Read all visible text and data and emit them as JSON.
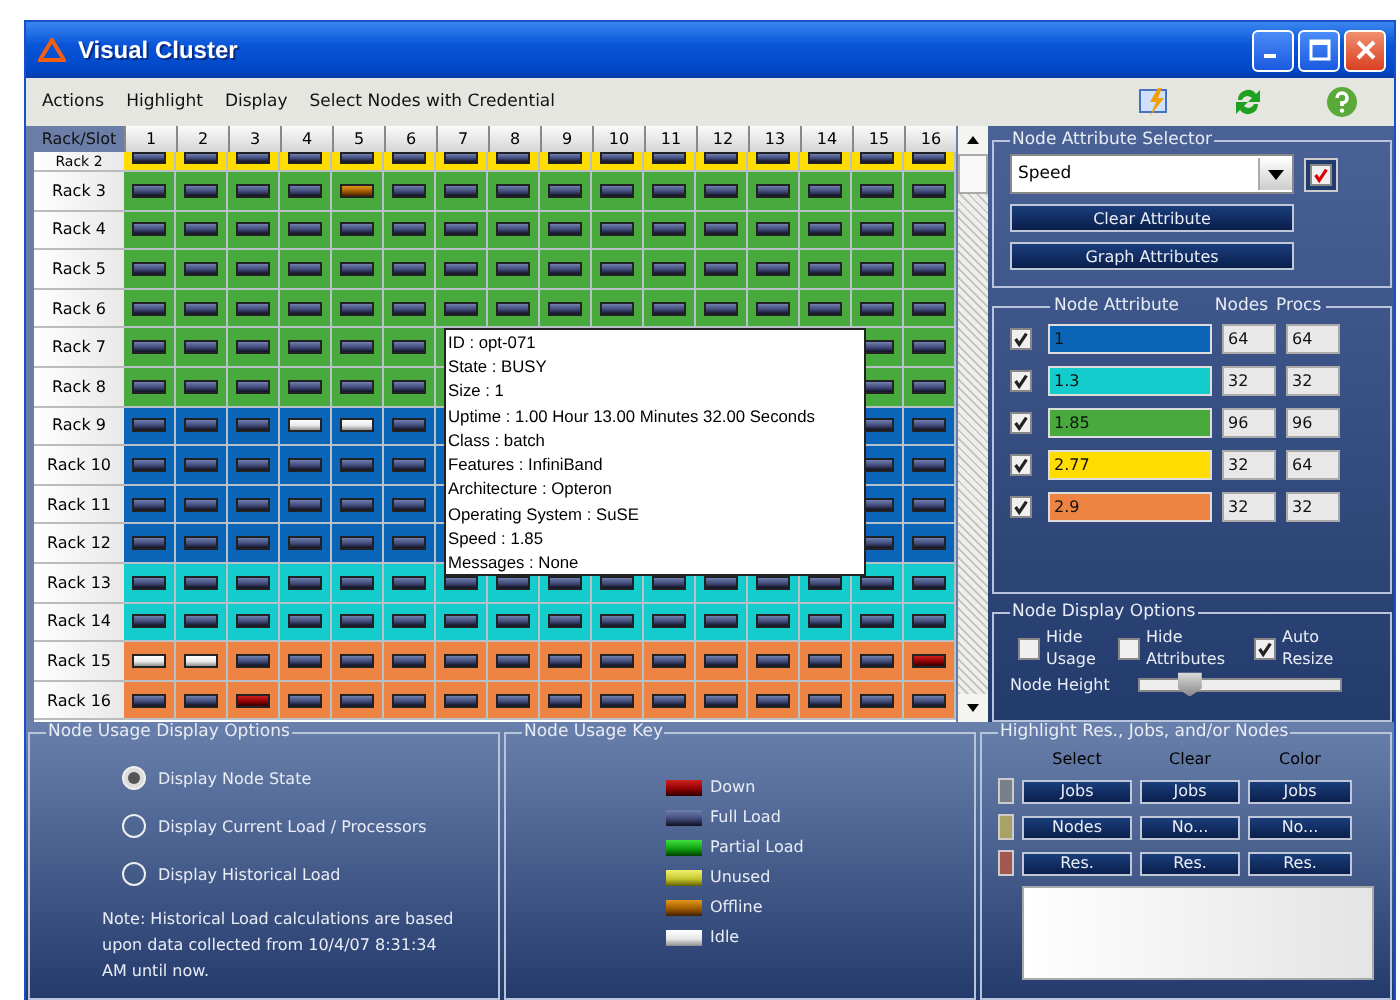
{
  "window": {
    "title": "Visual Cluster"
  },
  "menu": [
    "Actions",
    "Highlight",
    "Display",
    "Select Nodes with Credential"
  ],
  "grid": {
    "corner": "Rack/Slot",
    "slots": [
      "1",
      "2",
      "3",
      "4",
      "5",
      "6",
      "7",
      "8",
      "9",
      "10",
      "11",
      "12",
      "13",
      "14",
      "15",
      "16"
    ],
    "racks": [
      {
        "label": "Rack 2",
        "color": "#ffdd00",
        "nodes": [
          {
            "kind": "full"
          },
          {
            "kind": "full"
          },
          {
            "kind": "full"
          },
          {
            "kind": "full"
          },
          {
            "kind": "full"
          },
          {
            "kind": "full"
          },
          {
            "kind": "full"
          },
          {
            "kind": "full"
          },
          {
            "kind": "full"
          },
          {
            "kind": "full"
          },
          {
            "kind": "full"
          },
          {
            "kind": "full"
          },
          {
            "kind": "full"
          },
          {
            "kind": "full"
          },
          {
            "kind": "full"
          },
          {
            "kind": "full"
          }
        ]
      },
      {
        "label": "Rack 3",
        "color": "#48aa3c",
        "nodes": [
          {
            "kind": "full"
          },
          {
            "kind": "full"
          },
          {
            "kind": "full"
          },
          {
            "kind": "full"
          },
          {
            "kind": "offline"
          },
          {
            "kind": "full"
          },
          {
            "kind": "full"
          },
          {
            "kind": "full"
          },
          {
            "kind": "full"
          },
          {
            "kind": "full"
          },
          {
            "kind": "full"
          },
          {
            "kind": "full"
          },
          {
            "kind": "full"
          },
          {
            "kind": "full"
          },
          {
            "kind": "full"
          },
          {
            "kind": "full"
          }
        ]
      },
      {
        "label": "Rack 4",
        "color": "#48aa3c",
        "nodes": [
          {
            "kind": "full"
          },
          {
            "kind": "full"
          },
          {
            "kind": "full"
          },
          {
            "kind": "full"
          },
          {
            "kind": "full"
          },
          {
            "kind": "full"
          },
          {
            "kind": "full"
          },
          {
            "kind": "full"
          },
          {
            "kind": "full"
          },
          {
            "kind": "full"
          },
          {
            "kind": "full"
          },
          {
            "kind": "full"
          },
          {
            "kind": "full"
          },
          {
            "kind": "full"
          },
          {
            "kind": "full"
          },
          {
            "kind": "full"
          }
        ]
      },
      {
        "label": "Rack 5",
        "color": "#48aa3c",
        "nodes": [
          {
            "kind": "full"
          },
          {
            "kind": "full"
          },
          {
            "kind": "full"
          },
          {
            "kind": "full"
          },
          {
            "kind": "full"
          },
          {
            "kind": "full"
          },
          {
            "kind": "full"
          },
          {
            "kind": "full"
          },
          {
            "kind": "full"
          },
          {
            "kind": "full"
          },
          {
            "kind": "full"
          },
          {
            "kind": "full"
          },
          {
            "kind": "full"
          },
          {
            "kind": "full"
          },
          {
            "kind": "full"
          },
          {
            "kind": "full"
          }
        ]
      },
      {
        "label": "Rack 6",
        "color": "#48aa3c",
        "nodes": [
          {
            "kind": "full"
          },
          {
            "kind": "full"
          },
          {
            "kind": "full"
          },
          {
            "kind": "full"
          },
          {
            "kind": "full"
          },
          {
            "kind": "full"
          },
          {
            "kind": "full"
          },
          {
            "kind": "full"
          },
          {
            "kind": "full"
          },
          {
            "kind": "full"
          },
          {
            "kind": "full"
          },
          {
            "kind": "full"
          },
          {
            "kind": "full"
          },
          {
            "kind": "full"
          },
          {
            "kind": "full"
          },
          {
            "kind": "full"
          }
        ]
      },
      {
        "label": "Rack 7",
        "color": "#48aa3c",
        "nodes": [
          {
            "kind": "full"
          },
          {
            "kind": "full"
          },
          {
            "kind": "full"
          },
          {
            "kind": "full"
          },
          {
            "kind": "full"
          },
          {
            "kind": "full"
          },
          {
            "kind": "hidden"
          },
          {
            "kind": "hidden"
          },
          {
            "kind": "hidden"
          },
          {
            "kind": "hidden"
          },
          {
            "kind": "hidden"
          },
          {
            "kind": "hidden"
          },
          {
            "kind": "hidden"
          },
          {
            "kind": "hidden"
          },
          {
            "kind": "full"
          },
          {
            "kind": "full"
          }
        ]
      },
      {
        "label": "Rack 8",
        "color": "#48aa3c",
        "nodes": [
          {
            "kind": "full"
          },
          {
            "kind": "full"
          },
          {
            "kind": "full"
          },
          {
            "kind": "full"
          },
          {
            "kind": "full"
          },
          {
            "kind": "full"
          },
          {
            "kind": "hidden"
          },
          {
            "kind": "hidden"
          },
          {
            "kind": "hidden"
          },
          {
            "kind": "hidden"
          },
          {
            "kind": "hidden"
          },
          {
            "kind": "hidden"
          },
          {
            "kind": "hidden"
          },
          {
            "kind": "hidden"
          },
          {
            "kind": "full"
          },
          {
            "kind": "full"
          }
        ]
      },
      {
        "label": "Rack 9",
        "color": "#0a64b8",
        "nodes": [
          {
            "kind": "full"
          },
          {
            "kind": "full"
          },
          {
            "kind": "full"
          },
          {
            "kind": "idle"
          },
          {
            "kind": "idle"
          },
          {
            "kind": "full"
          },
          {
            "kind": "hidden"
          },
          {
            "kind": "hidden"
          },
          {
            "kind": "hidden"
          },
          {
            "kind": "hidden"
          },
          {
            "kind": "hidden"
          },
          {
            "kind": "hidden"
          },
          {
            "kind": "hidden"
          },
          {
            "kind": "hidden"
          },
          {
            "kind": "full"
          },
          {
            "kind": "full"
          }
        ]
      },
      {
        "label": "Rack 10",
        "color": "#0a64b8",
        "nodes": [
          {
            "kind": "full"
          },
          {
            "kind": "full"
          },
          {
            "kind": "full"
          },
          {
            "kind": "full"
          },
          {
            "kind": "full"
          },
          {
            "kind": "full"
          },
          {
            "kind": "hidden"
          },
          {
            "kind": "hidden"
          },
          {
            "kind": "hidden"
          },
          {
            "kind": "hidden"
          },
          {
            "kind": "hidden"
          },
          {
            "kind": "hidden"
          },
          {
            "kind": "hidden"
          },
          {
            "kind": "hidden"
          },
          {
            "kind": "full"
          },
          {
            "kind": "full"
          }
        ]
      },
      {
        "label": "Rack 11",
        "color": "#0a64b8",
        "nodes": [
          {
            "kind": "full"
          },
          {
            "kind": "full"
          },
          {
            "kind": "full"
          },
          {
            "kind": "full"
          },
          {
            "kind": "full"
          },
          {
            "kind": "full"
          },
          {
            "kind": "hidden"
          },
          {
            "kind": "hidden"
          },
          {
            "kind": "hidden"
          },
          {
            "kind": "hidden"
          },
          {
            "kind": "hidden"
          },
          {
            "kind": "hidden"
          },
          {
            "kind": "hidden"
          },
          {
            "kind": "hidden"
          },
          {
            "kind": "full"
          },
          {
            "kind": "full"
          }
        ]
      },
      {
        "label": "Rack 12",
        "color": "#0a64b8",
        "nodes": [
          {
            "kind": "full"
          },
          {
            "kind": "full"
          },
          {
            "kind": "full"
          },
          {
            "kind": "full"
          },
          {
            "kind": "full"
          },
          {
            "kind": "full"
          },
          {
            "kind": "hidden"
          },
          {
            "kind": "hidden"
          },
          {
            "kind": "hidden"
          },
          {
            "kind": "hidden"
          },
          {
            "kind": "hidden"
          },
          {
            "kind": "hidden"
          },
          {
            "kind": "hidden"
          },
          {
            "kind": "hidden"
          },
          {
            "kind": "full"
          },
          {
            "kind": "full"
          }
        ]
      },
      {
        "label": "Rack 13",
        "color": "#14cccc",
        "nodes": [
          {
            "kind": "full"
          },
          {
            "kind": "full"
          },
          {
            "kind": "full"
          },
          {
            "kind": "full"
          },
          {
            "kind": "full"
          },
          {
            "kind": "full"
          },
          {
            "kind": "full"
          },
          {
            "kind": "full"
          },
          {
            "kind": "full"
          },
          {
            "kind": "full"
          },
          {
            "kind": "full"
          },
          {
            "kind": "full"
          },
          {
            "kind": "full"
          },
          {
            "kind": "full"
          },
          {
            "kind": "full"
          },
          {
            "kind": "full"
          }
        ]
      },
      {
        "label": "Rack 14",
        "color": "#14cccc",
        "nodes": [
          {
            "kind": "full"
          },
          {
            "kind": "full"
          },
          {
            "kind": "full"
          },
          {
            "kind": "full"
          },
          {
            "kind": "full"
          },
          {
            "kind": "full"
          },
          {
            "kind": "full"
          },
          {
            "kind": "full"
          },
          {
            "kind": "full"
          },
          {
            "kind": "full"
          },
          {
            "kind": "full"
          },
          {
            "kind": "full"
          },
          {
            "kind": "full"
          },
          {
            "kind": "full"
          },
          {
            "kind": "full"
          },
          {
            "kind": "full"
          }
        ]
      },
      {
        "label": "Rack 15",
        "color": "#ee8444",
        "nodes": [
          {
            "kind": "idle"
          },
          {
            "kind": "idle"
          },
          {
            "kind": "full"
          },
          {
            "kind": "full"
          },
          {
            "kind": "full"
          },
          {
            "kind": "full"
          },
          {
            "kind": "full"
          },
          {
            "kind": "full"
          },
          {
            "kind": "full"
          },
          {
            "kind": "full"
          },
          {
            "kind": "full"
          },
          {
            "kind": "full"
          },
          {
            "kind": "full"
          },
          {
            "kind": "full"
          },
          {
            "kind": "full"
          },
          {
            "kind": "down"
          }
        ]
      },
      {
        "label": "Rack 16",
        "color": "#ee8444",
        "nodes": [
          {
            "kind": "full"
          },
          {
            "kind": "full"
          },
          {
            "kind": "down"
          },
          {
            "kind": "full"
          },
          {
            "kind": "full"
          },
          {
            "kind": "full"
          },
          {
            "kind": "full"
          },
          {
            "kind": "full"
          },
          {
            "kind": "full"
          },
          {
            "kind": "full"
          },
          {
            "kind": "full"
          },
          {
            "kind": "full"
          },
          {
            "kind": "full"
          },
          {
            "kind": "full"
          },
          {
            "kind": "full"
          },
          {
            "kind": "full"
          }
        ]
      }
    ]
  },
  "tooltip": {
    "lines": [
      "ID : opt-071",
      "State : BUSY",
      "Size : 1",
      "Uptime : 1.00 Hour 13.00 Minutes 32.00 Seconds",
      "Class : batch",
      "Features : InfiniBand",
      "Architecture : Opteron",
      "Operating System : SuSE",
      "Speed : 1.85",
      "Messages : None"
    ]
  },
  "attribute_selector": {
    "title": "Node Attribute Selector",
    "dropdown": {
      "value": "Speed"
    },
    "checked": true,
    "buttons": [
      "Clear Attribute",
      "Graph Attributes"
    ]
  },
  "attributes": {
    "headers": [
      "Node Attribute",
      "Nodes",
      "Procs"
    ],
    "rows": [
      {
        "checked": true,
        "value": "1",
        "color": "#0a64b8",
        "nodes": "64",
        "procs": "64"
      },
      {
        "checked": true,
        "value": "1.3",
        "color": "#14cccc",
        "nodes": "32",
        "procs": "32"
      },
      {
        "checked": true,
        "value": "1.85",
        "color": "#48aa3c",
        "nodes": "96",
        "procs": "96"
      },
      {
        "checked": true,
        "value": "2.77",
        "color": "#ffdd00",
        "nodes": "32",
        "procs": "64"
      },
      {
        "checked": true,
        "value": "2.9",
        "color": "#ee8444",
        "nodes": "32",
        "procs": "32"
      }
    ]
  },
  "display_options": {
    "title": "Node Display Options",
    "checkboxes": [
      {
        "label": "Hide Usage",
        "checked": false
      },
      {
        "label": "Hide Attributes",
        "checked": false
      },
      {
        "label": "Auto Resize",
        "checked": true
      }
    ],
    "slider": {
      "label": "Node Height",
      "level": 0.25
    }
  },
  "usage_options": {
    "title": "Node Usage Display Options",
    "radios": [
      {
        "label": "Display Node State",
        "selected": true
      },
      {
        "label": "Display Current Load / Processors",
        "selected": false
      },
      {
        "label": "Display Historical Load",
        "selected": false
      }
    ],
    "note": "Note: Historical Load calculations are based upon data collected from 10/4/07 8:31:34 AM until now."
  },
  "usage_key": {
    "title": "Node Usage Key",
    "items": [
      {
        "label": "Down",
        "kind": "down"
      },
      {
        "label": "Full Load",
        "kind": "full"
      },
      {
        "label": "Partial Load",
        "kind": "partial"
      },
      {
        "label": "Unused",
        "kind": "unused"
      },
      {
        "label": "Offline",
        "kind": "offline"
      },
      {
        "label": "Idle",
        "kind": "idle"
      }
    ]
  },
  "highlight": {
    "title": "Highlight Res., Jobs, and/or Nodes",
    "columns": [
      "Select",
      "Clear",
      "Color"
    ],
    "rows": [
      {
        "color": "#78808a",
        "buttons": [
          "Jobs",
          "Jobs",
          "Jobs"
        ]
      },
      {
        "color": "#a8a264",
        "buttons": [
          "Nodes",
          "No...",
          "No..."
        ]
      },
      {
        "color": "#a05850",
        "buttons": [
          "Res.",
          "Res.",
          "Res."
        ]
      }
    ]
  }
}
